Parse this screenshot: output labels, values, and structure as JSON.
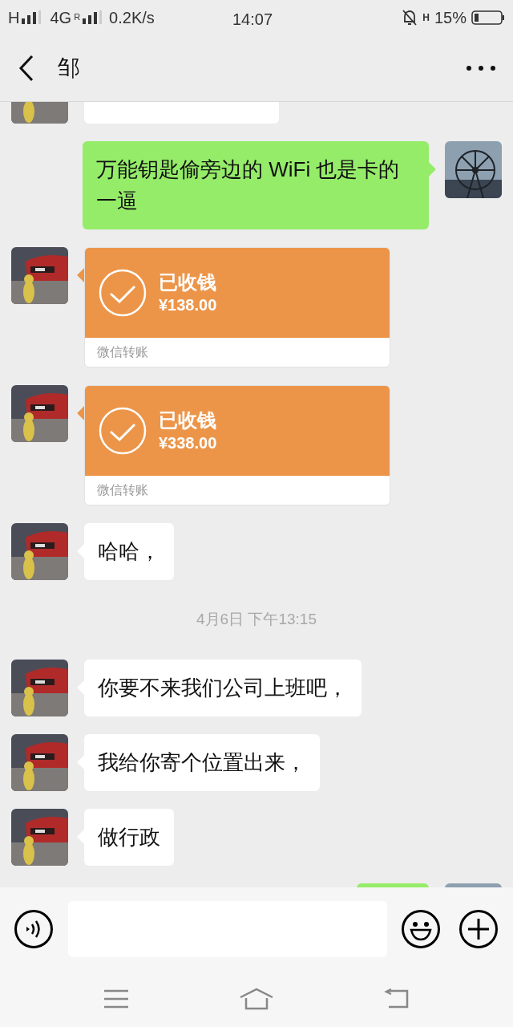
{
  "status_bar": {
    "network_1": "H",
    "network_2": "4G",
    "roaming": "R",
    "speed": "0.2K/s",
    "time": "14:07",
    "network_3": "H",
    "battery": "15%"
  },
  "header": {
    "title": "邹"
  },
  "messages": [
    {
      "kind": "text",
      "mine": false
    },
    {
      "kind": "text",
      "mine": true,
      "text": "万能钥匙偷旁边的 WiFi 也是卡的一逼"
    },
    {
      "kind": "transfer",
      "mine": false,
      "status": "已收钱",
      "amount": "¥138.00",
      "footer": "微信转账"
    },
    {
      "kind": "transfer",
      "mine": false,
      "status": "已收钱",
      "amount": "¥338.00",
      "footer": "微信转账"
    },
    {
      "kind": "text",
      "mine": false,
      "text": "哈哈，"
    },
    {
      "kind": "time",
      "text": "4月6日 下午13:15"
    },
    {
      "kind": "text",
      "mine": false,
      "text": "你要不来我们公司上班吧，"
    },
    {
      "kind": "text",
      "mine": false,
      "text": "我给你寄个位置出来，"
    },
    {
      "kind": "text",
      "mine": false,
      "text": "做行政"
    },
    {
      "kind": "text",
      "mine": true
    }
  ]
}
